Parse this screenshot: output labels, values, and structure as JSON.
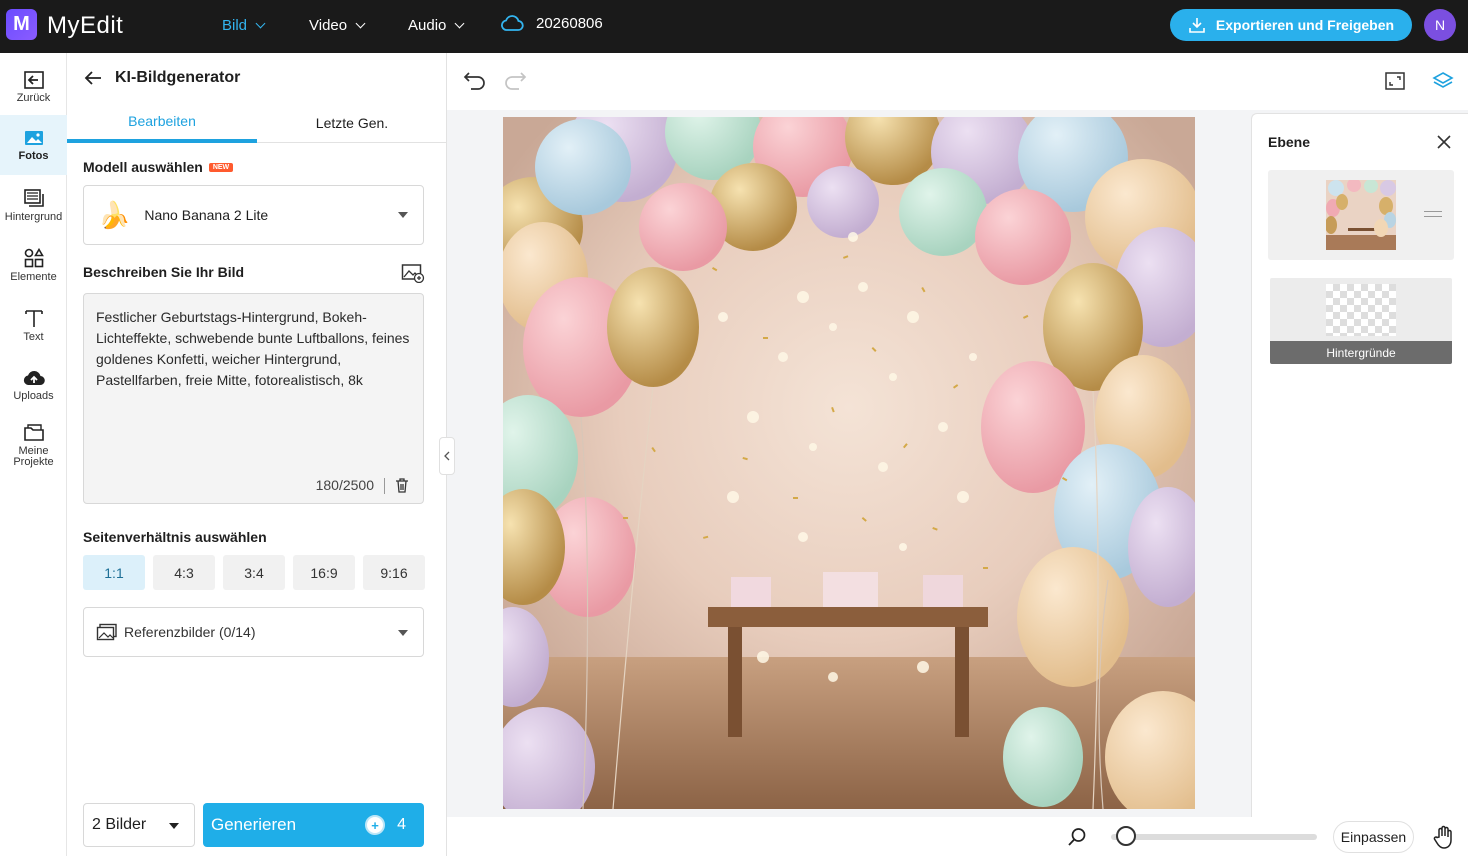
{
  "app": {
    "logo_letter": "M",
    "name": "MyEdit"
  },
  "nav": [
    {
      "label": "Bild",
      "active": true
    },
    {
      "label": "Video",
      "active": false
    },
    {
      "label": "Audio",
      "active": false
    }
  ],
  "project_name": "20260806",
  "export_label": "Exportieren und Freigeben",
  "avatar_initial": "N",
  "rail": [
    {
      "label": "Zurück",
      "icon": "back-arrow-icon"
    },
    {
      "label": "Fotos",
      "icon": "photo-icon",
      "active": true
    },
    {
      "label": "Hintergrund",
      "icon": "background-icon"
    },
    {
      "label": "Elemente",
      "icon": "elements-icon"
    },
    {
      "label": "Text",
      "icon": "text-icon"
    },
    {
      "label": "Uploads",
      "icon": "upload-cloud-icon"
    },
    {
      "label": "Meine Projekte",
      "icon": "folder-icon"
    }
  ],
  "panel": {
    "title": "KI-Bildgenerator",
    "tabs": [
      {
        "label": "Bearbeiten",
        "active": true
      },
      {
        "label": "Letzte Gen.",
        "active": false
      }
    ],
    "model_label": "Modell auswählen",
    "new_badge": "NEW",
    "model_value": "Nano Banana 2 Lite",
    "model_emoji": "🍌",
    "describe_label": "Beschreiben Sie Ihr Bild",
    "prompt_text": "Festlicher Geburtstags-Hintergrund, Bokeh-Lichteffekte, schwebende bunte Luftballons, feines goldenes Konfetti, weicher Hintergrund, Pastellfarben, freie Mitte, fotorealistisch, 8k",
    "prompt_counter": "180/2500",
    "ratio_label": "Seitenverhältnis auswählen",
    "ratios": [
      {
        "label": "1:1",
        "active": true
      },
      {
        "label": "4:3",
        "active": false
      },
      {
        "label": "3:4",
        "active": false
      },
      {
        "label": "16:9",
        "active": false
      },
      {
        "label": "9:16",
        "active": false
      }
    ],
    "reference_label": "Referenzbilder (0/14)",
    "image_count": "2 Bilder",
    "generate_label": "Generieren",
    "generate_cost": "4"
  },
  "bottom": {
    "fit_label": "Einpassen",
    "zoom_fraction": 0.05
  },
  "layers": {
    "title": "Ebene",
    "background_label": "Hintergründe"
  },
  "colors": {
    "accent": "#1faee8",
    "topbar": "#1a1a1a",
    "avatar": "#7b4fe0"
  }
}
